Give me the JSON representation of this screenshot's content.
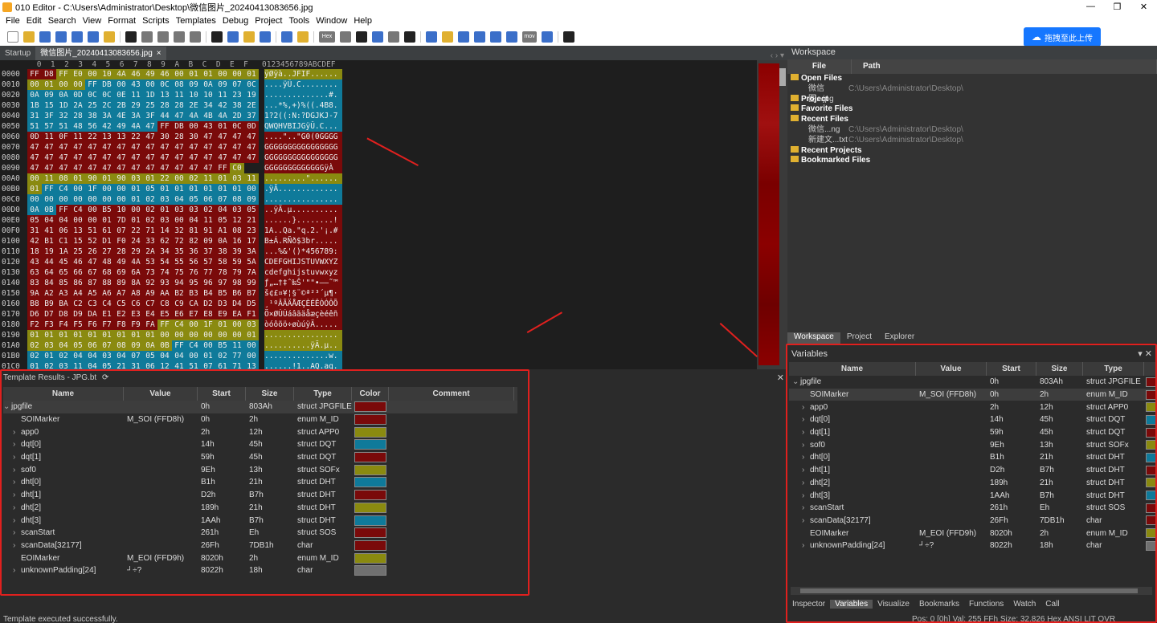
{
  "window": {
    "title": "010 Editor - C:\\Users\\Administrator\\Desktop\\微信图片_20240413083656.jpg",
    "min": "—",
    "max": "❐",
    "close": "✕"
  },
  "menu": [
    "File",
    "Edit",
    "Search",
    "View",
    "Format",
    "Scripts",
    "Templates",
    "Debug",
    "Project",
    "Tools",
    "Window",
    "Help"
  ],
  "toolbar": {
    "upload_label": "拖拽至此上传",
    "hex_label": "Hex",
    "mov_label": "mov"
  },
  "tabs": {
    "startup": "Startup",
    "file": "微信图片_20240413083656.jpg",
    "close": "×",
    "nav": "‹ › ▾"
  },
  "hex": {
    "header": "        0  1  2  3  4  5  6  7  8  9  A  B  C  D  E  F   0123456789ABCDEF",
    "rows": [
      {
        "off": "0000",
        "b": "FF D8 FF E0 00 10 4A 46 49 46 00 01 01 00 00 01",
        "a": "ÿØÿà..JFIF......"
      },
      {
        "off": "0010",
        "b": "00 01 00 00 FF DB 00 43 00 0C 08 09 0A 09 07 0C",
        "a": "....ÿÛ.C........"
      },
      {
        "off": "0020",
        "b": "0A 09 0A 0D 0C 0C 0E 11 1D 13 11 10 10 11 23 19",
        "a": "..............#."
      },
      {
        "off": "0030",
        "b": "1B 15 1D 2A 25 2C 2B 29 25 28 28 2E 34 42 38 2E",
        "a": "...*%,+)%((.4B8."
      },
      {
        "off": "0040",
        "b": "31 3F 32 28 38 3A 4E 3A 3F 44 47 4A 4B 4A 2D 37",
        "a": "1?2((:N:?DGJKJ-7"
      },
      {
        "off": "0050",
        "b": "51 57 51 48 56 42 49 4A 47 FF DB 00 43 01 0C 0D",
        "a": "QWQHVBIJGÿÛ.C..."
      },
      {
        "off": "0060",
        "b": "0D 11 0F 11 22 13 13 22 47 30 28 30 47 47 47 47",
        "a": "....\"..\"G0(0GGGG"
      },
      {
        "off": "0070",
        "b": "47 47 47 47 47 47 47 47 47 47 47 47 47 47 47 47",
        "a": "GGGGGGGGGGGGGGGG"
      },
      {
        "off": "0080",
        "b": "47 47 47 47 47 47 47 47 47 47 47 47 47 47 47 47",
        "a": "GGGGGGGGGGGGGGGG"
      },
      {
        "off": "0090",
        "b": "47 47 47 47 47 47 47 47 47 47 47 47 47 FF C0",
        "a": "GGGGGGGGGGGGGÿÀ"
      },
      {
        "off": "00A0",
        "b": "00 11 08 01 90 01 90 03 01 22 00 02 11 01 03 11",
        "a": ".........\"......"
      },
      {
        "off": "00B0",
        "b": "01 FF C4 00 1F 00 00 01 05 01 01 01 01 01 01 00",
        "a": ".ÿÄ............."
      },
      {
        "off": "00C0",
        "b": "00 00 00 00 00 00 00 01 02 03 04 05 06 07 08 09",
        "a": "................"
      },
      {
        "off": "00D0",
        "b": "0A 0B FF C4 00 B5 10 00 02 01 03 03 02 04 03 05",
        "a": "..ÿÄ.µ.........."
      },
      {
        "off": "00E0",
        "b": "05 04 04 00 00 01 7D 01 02 03 00 04 11 05 12 21",
        "a": "......}........!"
      },
      {
        "off": "00F0",
        "b": "31 41 06 13 51 61 07 22 71 14 32 81 91 A1 08 23",
        "a": "1A..Qa.\"q.2.'¡.#"
      },
      {
        "off": "0100",
        "b": "42 B1 C1 15 52 D1 F0 24 33 62 72 82 09 0A 16 17",
        "a": "B±Á.RÑð$3br....."
      },
      {
        "off": "0110",
        "b": "18 19 1A 25 26 27 28 29 2A 34 35 36 37 38 39 3A",
        "a": "...%&'()*456789:"
      },
      {
        "off": "0120",
        "b": "43 44 45 46 47 48 49 4A 53 54 55 56 57 58 59 5A",
        "a": "CDEFGHIJSTUVWXYZ"
      },
      {
        "off": "0130",
        "b": "63 64 65 66 67 68 69 6A 73 74 75 76 77 78 79 7A",
        "a": "cdefghijstuvwxyz"
      },
      {
        "off": "0140",
        "b": "83 84 85 86 87 88 89 8A 92 93 94 95 96 97 98 99",
        "a": "ƒ„…†‡ˆ‰Š'\"\"•–—˜™"
      },
      {
        "off": "0150",
        "b": "9A A2 A3 A4 A5 A6 A7 A8 A9 AA B2 B3 B4 B5 B6 B7",
        "a": "š¢£¤¥¦§¨©ª²³´µ¶·"
      },
      {
        "off": "0160",
        "b": "B8 B9 BA C2 C3 C4 C5 C6 C7 C8 C9 CA D2 D3 D4 D5",
        "a": "¸¹ºÂÃÄÅÆÇÈÉÊÒÓÔÕ"
      },
      {
        "off": "0170",
        "b": "D6 D7 D8 D9 DA E1 E2 E3 E4 E5 E6 E7 E8 E9 EA F1",
        "a": "Ö×ØÙÚáâãäåæçèéêñ"
      },
      {
        "off": "0180",
        "b": "F2 F3 F4 F5 F6 F7 F8 F9 FA FF C4 00 1F 01 00 03",
        "a": "òóôõö÷øùúÿÄ....."
      },
      {
        "off": "0190",
        "b": "01 01 01 01 01 01 01 01 01 00 00 00 00 00 00 01",
        "a": "................"
      },
      {
        "off": "01A0",
        "b": "02 03 04 05 06 07 08 09 0A 0B FF C4 00 B5 11 00",
        "a": "..........ÿÄ.µ.."
      },
      {
        "off": "01B0",
        "b": "02 01 02 04 04 03 04 07 05 04 04 00 01 02 77 00",
        "a": "..............w."
      },
      {
        "off": "01C0",
        "b": "01 02 03 11 04 05 21 31 06 12 41 51 07 61 71 13",
        "a": "......!1..AQ.aq."
      }
    ]
  },
  "template": {
    "title": "Template Results - JPG.bt",
    "refresh": "⟳",
    "close": "✕",
    "columns": [
      "Name",
      "Value",
      "Start",
      "Size",
      "Type",
      "Color",
      "Comment"
    ],
    "rows": [
      {
        "caret": "⌄",
        "name": "jpgfile",
        "value": "",
        "start": "0h",
        "size": "803Ah",
        "type": "struct JPGFILE",
        "color": "#7a0a0a",
        "indent": 0
      },
      {
        "caret": "",
        "name": "SOIMarker",
        "value": "M_SOI (FFD8h)",
        "start": "0h",
        "size": "2h",
        "type": "enum M_ID",
        "color": "#7a0a0a",
        "indent": 1
      },
      {
        "caret": "›",
        "name": "app0",
        "value": "",
        "start": "2h",
        "size": "12h",
        "type": "struct APP0",
        "color": "#8a8a10",
        "indent": 1
      },
      {
        "caret": "›",
        "name": "dqt[0]",
        "value": "",
        "start": "14h",
        "size": "45h",
        "type": "struct DQT",
        "color": "#0f7a9a",
        "indent": 1
      },
      {
        "caret": "›",
        "name": "dqt[1]",
        "value": "",
        "start": "59h",
        "size": "45h",
        "type": "struct DQT",
        "color": "#7a0a0a",
        "indent": 1
      },
      {
        "caret": "›",
        "name": "sof0",
        "value": "",
        "start": "9Eh",
        "size": "13h",
        "type": "struct SOFx",
        "color": "#8a8a10",
        "indent": 1
      },
      {
        "caret": "›",
        "name": "dht[0]",
        "value": "",
        "start": "B1h",
        "size": "21h",
        "type": "struct DHT",
        "color": "#0f7a9a",
        "indent": 1
      },
      {
        "caret": "›",
        "name": "dht[1]",
        "value": "",
        "start": "D2h",
        "size": "B7h",
        "type": "struct DHT",
        "color": "#7a0a0a",
        "indent": 1
      },
      {
        "caret": "›",
        "name": "dht[2]",
        "value": "",
        "start": "189h",
        "size": "21h",
        "type": "struct DHT",
        "color": "#8a8a10",
        "indent": 1
      },
      {
        "caret": "›",
        "name": "dht[3]",
        "value": "",
        "start": "1AAh",
        "size": "B7h",
        "type": "struct DHT",
        "color": "#0f7a9a",
        "indent": 1
      },
      {
        "caret": "›",
        "name": "scanStart",
        "value": "",
        "start": "261h",
        "size": "Eh",
        "type": "struct SOS",
        "color": "#7a0a0a",
        "indent": 1
      },
      {
        "caret": "›",
        "name": "scanData[32177]",
        "value": "",
        "start": "26Fh",
        "size": "7DB1h",
        "type": "char",
        "color": "#7a0a0a",
        "indent": 1
      },
      {
        "caret": "",
        "name": "EOIMarker",
        "value": "M_EOI (FFD9h)",
        "start": "8020h",
        "size": "2h",
        "type": "enum M_ID",
        "color": "#8a8a10",
        "indent": 1
      },
      {
        "caret": "›",
        "name": "unknownPadding[24]",
        "value": "┘÷?",
        "start": "8022h",
        "size": "18h",
        "type": "char",
        "color": "#707070",
        "indent": 1
      }
    ],
    "status": "Template executed successfully."
  },
  "workspace": {
    "title": "Workspace",
    "columns": [
      "File",
      "Path"
    ],
    "open_files": "Open Files",
    "open_file_name": "微信图...jpg",
    "open_file_path": "C:\\Users\\Administrator\\Desktop\\",
    "project": "Project",
    "favorites": "Favorite Files",
    "recent": "Recent Files",
    "recent1_name": "微信...ng",
    "recent1_path": "C:\\Users\\Administrator\\Desktop\\",
    "recent2_name": "新建文...txt",
    "recent2_path": "C:\\Users\\Administrator\\Desktop\\",
    "recent_projects": "Recent Projects",
    "bookmarked": "Bookmarked Files",
    "tab_workspace": "Workspace",
    "tab_project": "Project",
    "tab_explorer": "Explorer"
  },
  "variables": {
    "title": "Variables",
    "columns": [
      "Name",
      "Value",
      "Start",
      "Size",
      "Type"
    ],
    "tabs": [
      "Inspector",
      "Variables",
      "Visualize",
      "Bookmarks",
      "Functions",
      "Watch",
      "Call"
    ],
    "status": "Pos: 0 [0h]   Val: 255 FFh   Size: 32,826      Hex   ANSI   LIT      OVR"
  },
  "colors": {
    "red": "#7a0a0a",
    "olive": "#8a8a10",
    "teal": "#0f7a9a",
    "annotation": "#e0201e",
    "accent": "#1677ff"
  }
}
